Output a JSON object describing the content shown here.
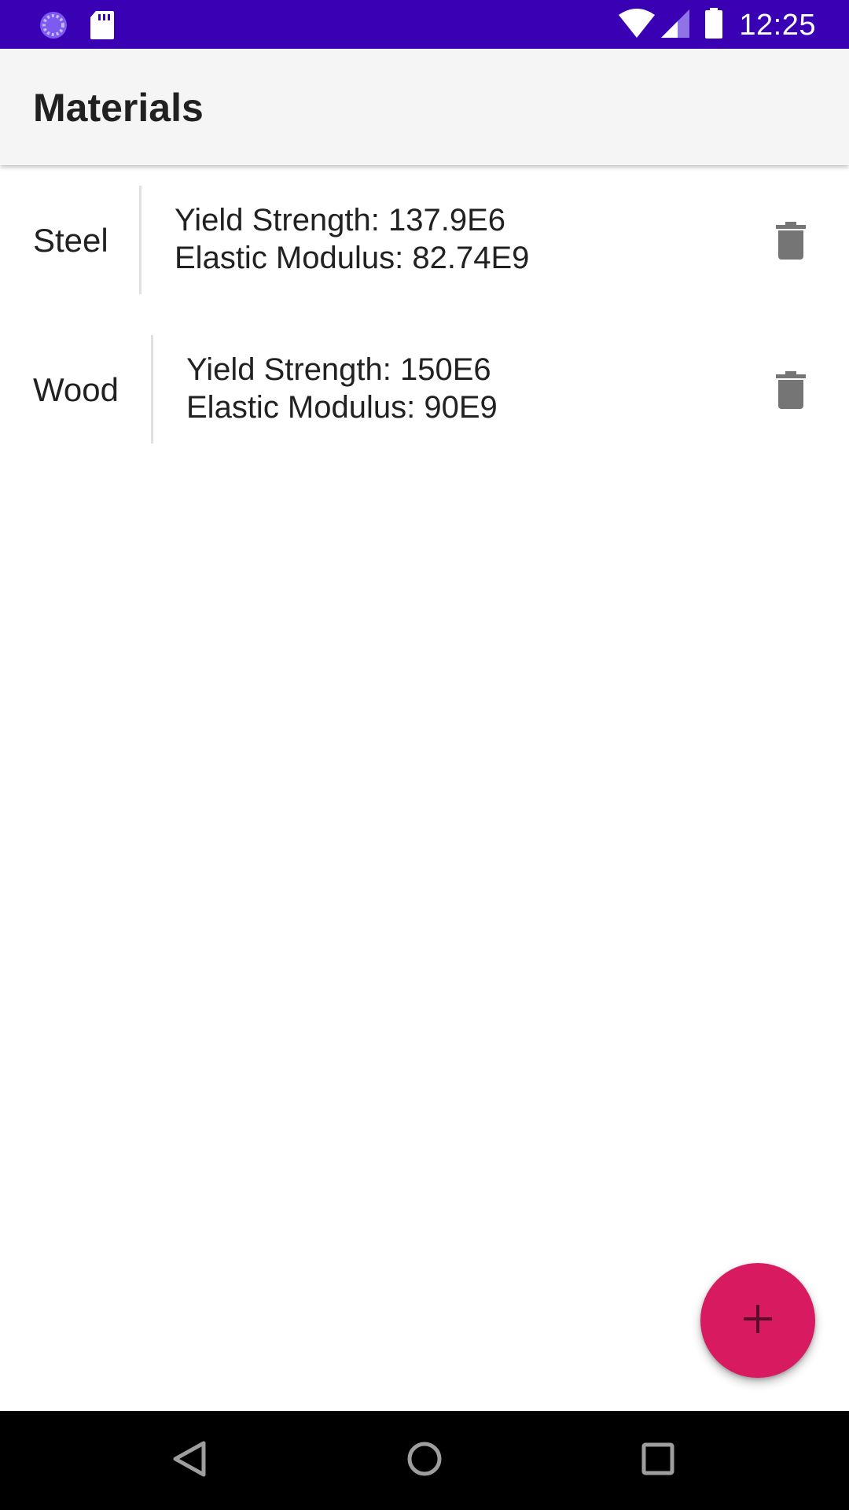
{
  "status_bar": {
    "time": "12:25",
    "background": "#3a00b3",
    "icons": [
      "loading-icon",
      "sd-card-icon",
      "wifi-icon",
      "signal-icon",
      "battery-icon"
    ]
  },
  "app_bar": {
    "title": "Materials"
  },
  "materials": [
    {
      "name": "Steel",
      "yield_strength": "Yield Strength: 137.9E6",
      "elastic_modulus": "Elastic Modulus: 82.74E9",
      "delete_icon": "trash-icon"
    },
    {
      "name": "Wood",
      "yield_strength": "Yield Strength: 150E6",
      "elastic_modulus": "Elastic Modulus: 90E9",
      "delete_icon": "trash-icon"
    }
  ],
  "fab": {
    "icon": "plus-icon",
    "color": "#d81b60"
  },
  "nav_bar": {
    "icons": [
      "back-icon",
      "home-icon",
      "recents-icon"
    ]
  }
}
